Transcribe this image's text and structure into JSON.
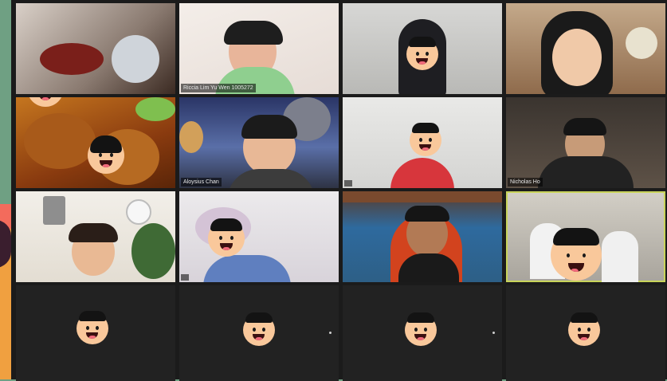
{
  "meeting": {
    "participants": [
      {
        "name": "",
        "state": "video"
      },
      {
        "name": "Riccia Lim Yu Wen 1005272",
        "state": "video"
      },
      {
        "name": "",
        "state": "video"
      },
      {
        "name": "",
        "state": "video"
      },
      {
        "name": "",
        "state": "video"
      },
      {
        "name": "Aloysius Chan",
        "state": "video"
      },
      {
        "name": "",
        "state": "video"
      },
      {
        "name": "Nicholas Ho",
        "state": "video"
      },
      {
        "name": "",
        "state": "video"
      },
      {
        "name": "",
        "state": "video"
      },
      {
        "name": "",
        "state": "video"
      },
      {
        "name": "",
        "state": "video",
        "active_speaker": true
      },
      {
        "name": "",
        "state": "video-off"
      },
      {
        "name": "",
        "state": "video-off"
      },
      {
        "name": "",
        "state": "video-off"
      },
      {
        "name": "",
        "state": "video-off"
      }
    ]
  },
  "colors": {
    "background": "#6fa083",
    "grid_bg": "#1b1b1b",
    "active_border": "#c8d45a",
    "sticker_skin": "#f9c89b",
    "sticker_hair": "#131313"
  },
  "icons": [
    "smiley-face-sticker-icon",
    "microphone-muted-icon"
  ]
}
